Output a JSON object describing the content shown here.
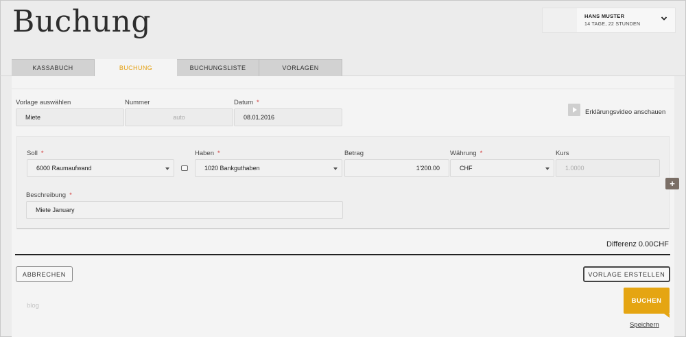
{
  "page": {
    "title": "Buchung"
  },
  "user": {
    "name": "HANS MUSTER",
    "time_left": "14 TAGE, 22 STUNDEN",
    "menu_icon": "chevron-down-icon"
  },
  "tabs": [
    {
      "label": "KASSABUCH",
      "active": false
    },
    {
      "label": "BUCHUNG",
      "active": true
    },
    {
      "label": "BUCHUNGSLISTE",
      "active": false
    },
    {
      "label": "VORLAGEN",
      "active": false
    }
  ],
  "form": {
    "vorlage": {
      "label": "Vorlage auswählen",
      "value": "Miete"
    },
    "nummer": {
      "label": "Nummer",
      "placeholder": "auto"
    },
    "datum": {
      "label": "Datum",
      "required": "*",
      "value": "08.01.2016"
    },
    "video": {
      "label": "Erklärungsvideo anschauen",
      "icon": "play-icon"
    }
  },
  "posting": {
    "soll": {
      "label": "Soll",
      "required": "*",
      "value": "6000 Raumaufwand"
    },
    "haben": {
      "label": "Haben",
      "required": "*",
      "value": "1020 Bankguthaben"
    },
    "betrag": {
      "label": "Betrag",
      "value": "1'200.00"
    },
    "waehrung": {
      "label": "Währung",
      "required": "*",
      "value": "CHF"
    },
    "kurs": {
      "label": "Kurs",
      "placeholder": "1.0000"
    },
    "beschreibung": {
      "label": "Beschreibung",
      "required": "*",
      "value": "Miete January"
    },
    "add_label": "+"
  },
  "summary": {
    "difference": "Differenz 0.00CHF"
  },
  "actions": {
    "cancel": "ABBRECHEN",
    "create_template": "VORLAGE ERSTELLEN",
    "book": "BUCHEN",
    "save": "Speichern",
    "blog": "blog"
  },
  "colors": {
    "accent": "#e5a512",
    "required": "#d23a3a",
    "add_button": "#7a6e66"
  }
}
